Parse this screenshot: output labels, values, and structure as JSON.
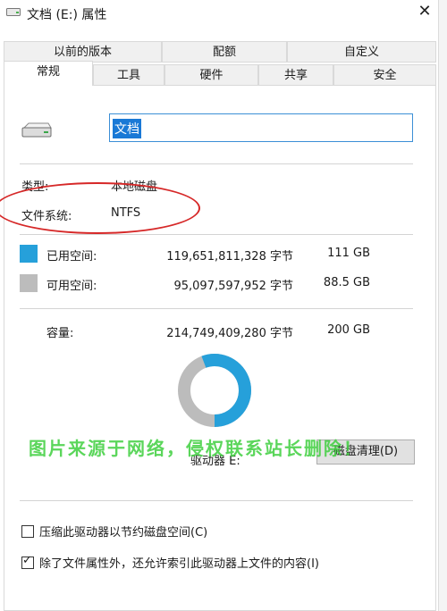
{
  "window": {
    "title": "文档 (E:) 属性",
    "close_glyph": "✕"
  },
  "tabs_row1": [
    "以前的版本",
    "配额",
    "自定义"
  ],
  "tabs_row2": [
    "常规",
    "工具",
    "硬件",
    "共享",
    "安全"
  ],
  "general": {
    "name_value": "文档",
    "type_label": "类型:",
    "type_value": "本地磁盘",
    "fs_label": "文件系统:",
    "fs_value": "NTFS",
    "used_label": "已用空间:",
    "used_bytes": "119,651,811,328 字节",
    "used_size": "111 GB",
    "free_label": "可用空间:",
    "free_bytes": "95,097,597,952 字节",
    "free_size": "88.5 GB",
    "cap_label": "容量:",
    "cap_bytes": "214,749,409,280 字节",
    "cap_size": "200 GB",
    "drive_label": "驱动器 E:",
    "cleanup_button": "磁盘清理(D)",
    "compress_label": "压缩此驱动器以节约磁盘空间(C)",
    "index_label": "除了文件属性外，还允许索引此驱动器上文件的内容(I)"
  },
  "usage": {
    "used_fraction": 0.557
  },
  "watermark": "图片来源于网络，侵权联系站长删除！",
  "colors": {
    "used": "#26a0da",
    "free": "#bcbcbc",
    "annotation": "#d62828",
    "watermark": "#3fcf3f"
  }
}
